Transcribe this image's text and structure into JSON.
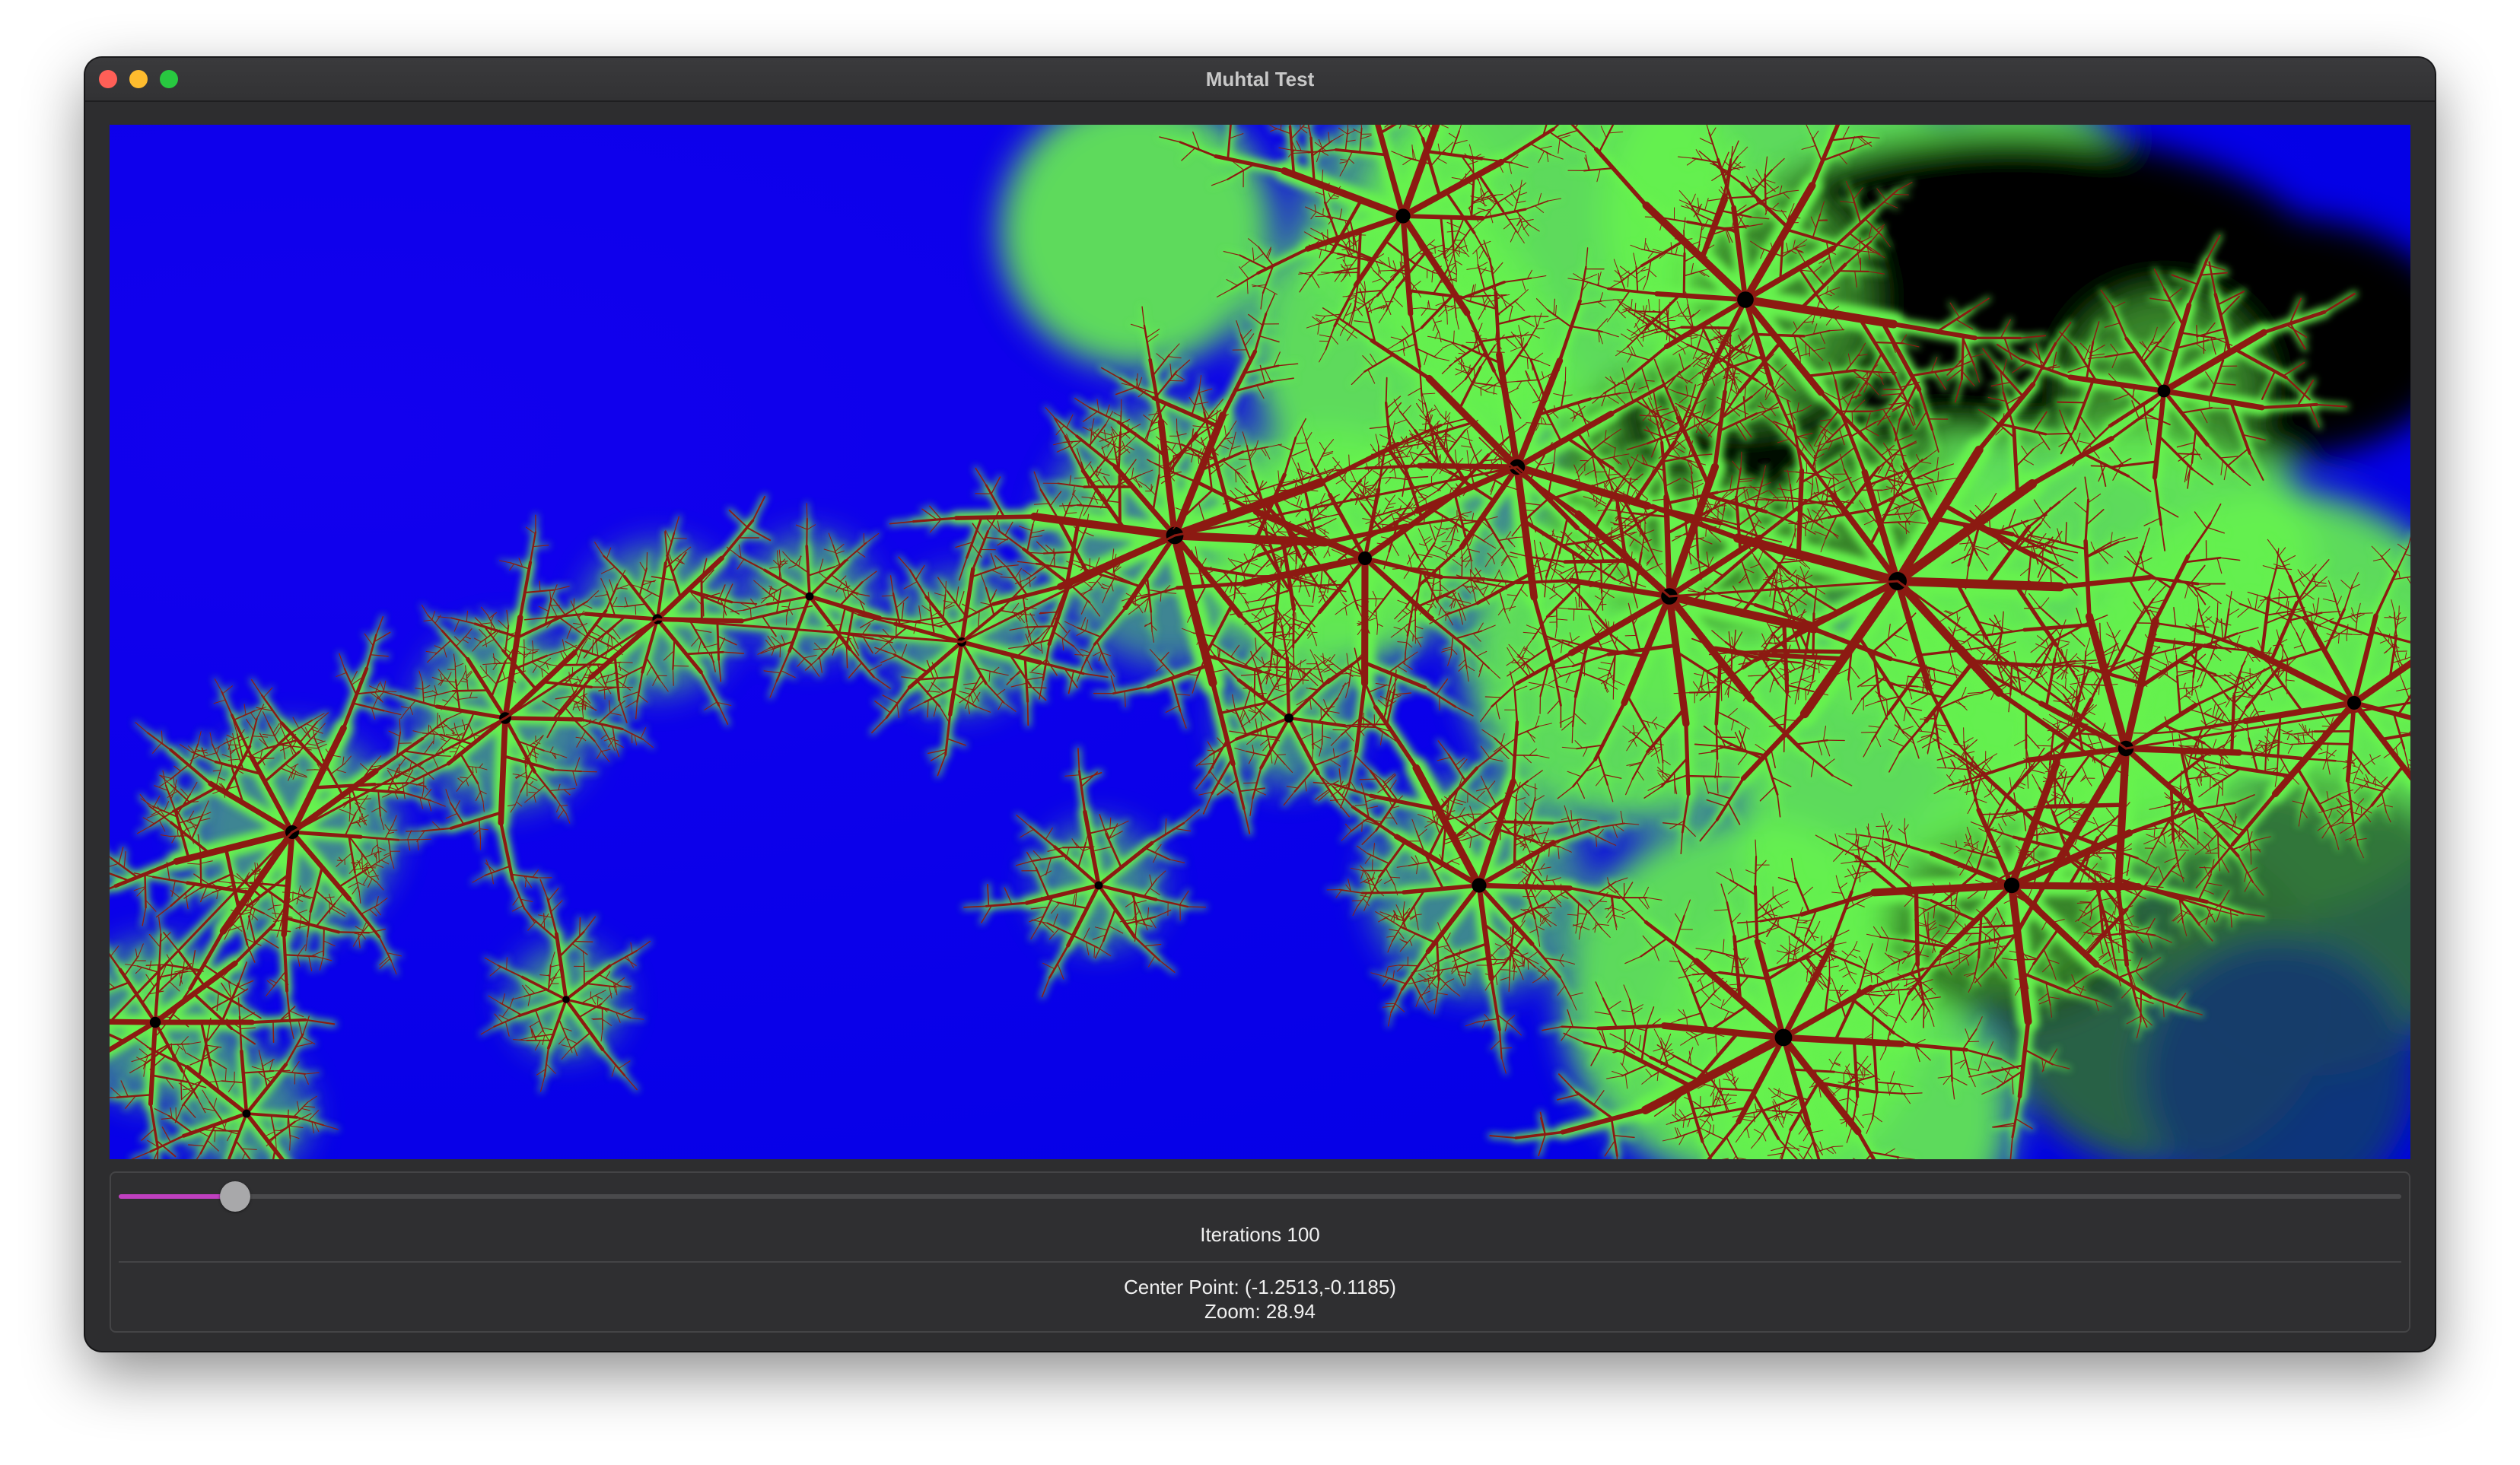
{
  "window": {
    "title": "Muhtal Test"
  },
  "fractal": {
    "colors": {
      "exterior": "#0000e6",
      "green": "#66f24d",
      "red": "#8c1a12",
      "black": "#000000",
      "dark_green": "#2e6b35"
    }
  },
  "controls": {
    "iterations_slider": {
      "value": 100,
      "fill_fraction": 0.051
    },
    "iterations_label": "Iterations 100",
    "center_point": "Center Point: (-1.2513,-0.1185)",
    "zoom": "Zoom: 28.94",
    "accent_color": "#c040c0"
  }
}
